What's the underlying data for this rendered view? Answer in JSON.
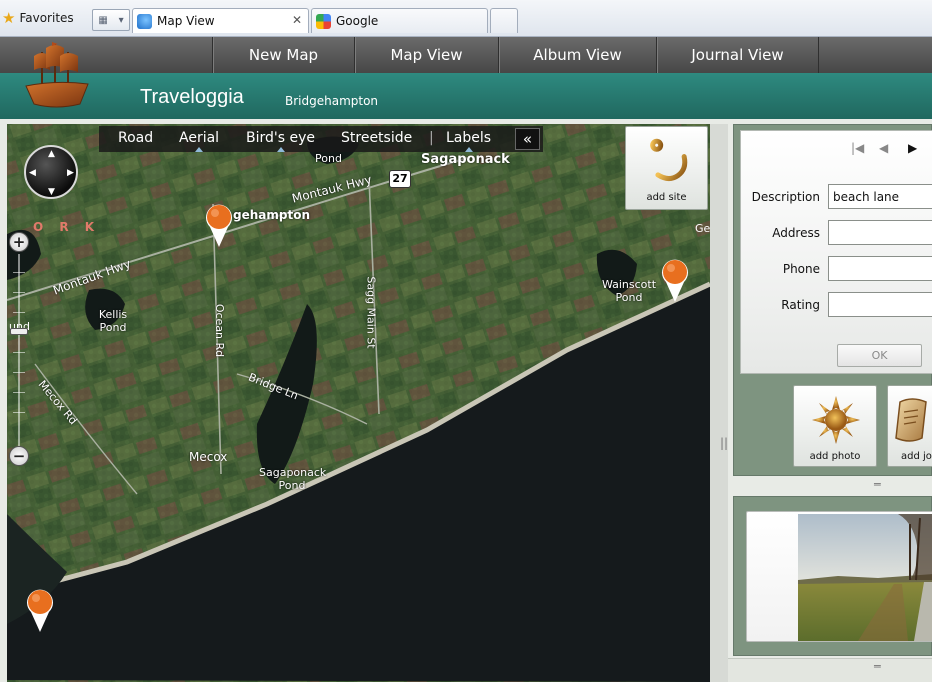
{
  "browser": {
    "favorites_label": "Favorites",
    "tabs": [
      {
        "label": "Map View",
        "active": true
      },
      {
        "label": "Google",
        "active": false
      }
    ]
  },
  "app": {
    "title": "Traveloggia",
    "location": "Bridgehampton",
    "nav": [
      "New Map",
      "Map View",
      "Album View",
      "Journal View"
    ],
    "colors": {
      "brand_teal": "#2e8a80",
      "nav_gray": "#5a5a5a",
      "panel_green": "#7e9480",
      "pin_orange": "#e86f1f"
    }
  },
  "map": {
    "toolbar": {
      "road": "Road",
      "aerial": "Aerial",
      "birds_eye": "Bird's eye",
      "streetside": "Streetside",
      "labels": "Labels",
      "collapse": "«"
    },
    "labels": {
      "sagaponack": "Sagaponack",
      "pond_top": "Pond",
      "route_27": "27",
      "montauk_hwy_1": "Montauk Hwy",
      "montauk_hwy_2": "Montauk Hwy",
      "bridgehampton": "gehampton",
      "york": "O R K",
      "kellis_pond": "Kellis Pond",
      "ocean_rd": "Ocean Rd",
      "sagg_main_st": "Sagg Main St",
      "bridge_ln": "Bridge Ln",
      "wainscott_pond": "Wainscott Pond",
      "mecox_rd": "Mecox Rd",
      "mecox": "Mecox",
      "sagaponack_pond": "Sagaponack Pond",
      "ge": "Ge",
      "und": "und"
    },
    "add_site_label": "add site"
  },
  "form": {
    "description_label": "Description",
    "description_value": "beach lane",
    "address_label": "Address",
    "address_value": "",
    "phone_label": "Phone",
    "phone_value": "",
    "rating_label": "Rating",
    "rating_value": "",
    "ok_label": "OK"
  },
  "actions": {
    "add_photo_label": "add photo",
    "add_journal_label": "add jo"
  }
}
